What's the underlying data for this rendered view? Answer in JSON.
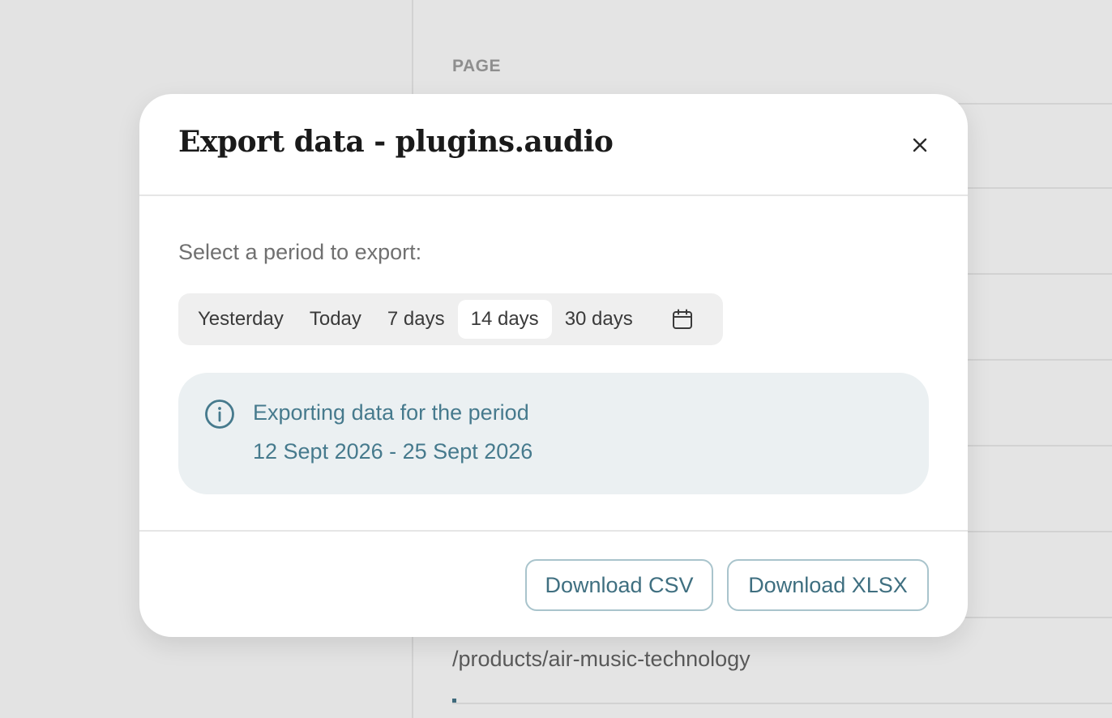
{
  "background": {
    "column_header": "PAGE",
    "row_text": "/products/air-music-technology"
  },
  "modal": {
    "title": "Export data - plugins.audio",
    "close_icon": "close-icon",
    "prompt": "Select a period to export:",
    "periods": [
      {
        "label": "Yesterday",
        "selected": false
      },
      {
        "label": "Today",
        "selected": false
      },
      {
        "label": "7 days",
        "selected": false
      },
      {
        "label": "14 days",
        "selected": true
      },
      {
        "label": "30 days",
        "selected": false
      }
    ],
    "calendar_icon": "calendar-icon",
    "info": {
      "icon": "info-icon",
      "line1": "Exporting data for the period",
      "line2": "12 Sept 2026 - 25 Sept 2026"
    },
    "buttons": {
      "csv": "Download CSV",
      "xlsx": "Download XLSX"
    }
  },
  "colors": {
    "accent": "#467a8d",
    "button_border": "#a9c4cc",
    "info_bg": "#ebf0f2"
  }
}
